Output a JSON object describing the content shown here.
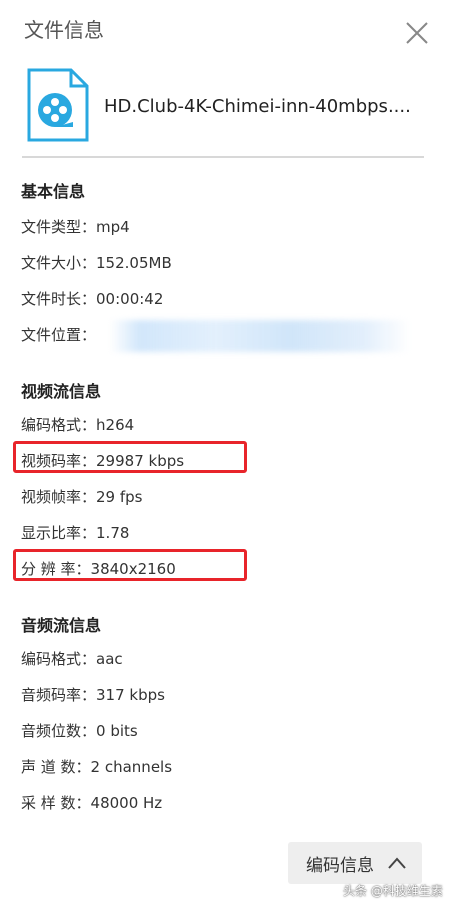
{
  "header": {
    "title": "文件信息"
  },
  "file": {
    "name": "HD.Club-4K-Chimei-inn-40mbps...."
  },
  "basic": {
    "title": "基本信息",
    "rows": [
      {
        "label": "文件类型：",
        "value": "mp4"
      },
      {
        "label": "文件大小：",
        "value": "152.05MB"
      },
      {
        "label": "文件时长：",
        "value": "00:00:42"
      },
      {
        "label": "文件位置：",
        "value": ""
      }
    ]
  },
  "video": {
    "title": "视频流信息",
    "rows": [
      {
        "label": "编码格式：",
        "value": "h264"
      },
      {
        "label": "视频码率：",
        "value": "29987 kbps"
      },
      {
        "label": "视频帧率：",
        "value": "29 fps"
      },
      {
        "label": "显示比率：",
        "value": "1.78"
      },
      {
        "label": "分 辨 率：",
        "value": "3840x2160"
      }
    ]
  },
  "audio": {
    "title": "音频流信息",
    "rows": [
      {
        "label": "编码格式：",
        "value": "aac"
      },
      {
        "label": "音频码率：",
        "value": "317 kbps"
      },
      {
        "label": "音频位数：",
        "value": "0 bits"
      },
      {
        "label": "声 道 数：",
        "value": "2 channels"
      },
      {
        "label": "采 样 数：",
        "value": "48000 Hz"
      }
    ]
  },
  "footer": {
    "code_button": "编码信息"
  },
  "watermark": "头条 @科技维生素",
  "colors": {
    "highlight": "#e8242a",
    "icon": "#29a8e0"
  },
  "icons": {
    "close": "close-icon",
    "file": "video-file-icon",
    "expand": "chevron-up-icon"
  }
}
